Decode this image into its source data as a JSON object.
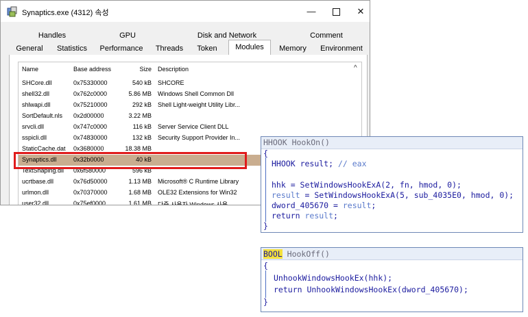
{
  "window": {
    "title": "Synaptics.exe (4312) 속성",
    "minimize_glyph": "—",
    "close_glyph": "✕"
  },
  "tabs": {
    "row1": [
      "Handles",
      "GPU",
      "Disk and Network",
      "Comment"
    ],
    "row2": [
      "General",
      "Statistics",
      "Performance",
      "Threads",
      "Token",
      "Modules",
      "Memory",
      "Environment"
    ],
    "selected": "Modules"
  },
  "modules_table": {
    "headers": [
      "Name",
      "Base address",
      "Size",
      "Description"
    ],
    "rows": [
      [
        "SHCore.dll",
        "0x75330000",
        "540 kB",
        "SHCORE"
      ],
      [
        "shell32.dll",
        "0x762c0000",
        "5.86 MB",
        "Windows Shell Common Dll"
      ],
      [
        "shlwapi.dll",
        "0x75210000",
        "292 kB",
        "Shell Light-weight Utility Libr..."
      ],
      [
        "SortDefault.nls",
        "0x2d00000",
        "3.22 MB",
        ""
      ],
      [
        "srvcli.dll",
        "0x747c0000",
        "116 kB",
        "Server Service Client DLL"
      ],
      [
        "sspicli.dll",
        "0x74830000",
        "132 kB",
        "Security Support Provider In..."
      ],
      [
        "StaticCache.dat",
        "0x3680000",
        "18.38 MB",
        ""
      ],
      [
        "Synaptics.dll",
        "0x32b0000",
        "40 kB",
        ""
      ],
      [
        "TextShaping.dll",
        "0x6f580000",
        "596 kB",
        ""
      ],
      [
        "ucrtbase.dll",
        "0x76d50000",
        "1.13 MB",
        "Microsoft® C Runtime Library"
      ],
      [
        "urlmon.dll",
        "0x70370000",
        "1.68 MB",
        "OLE32 Extensions for Win32"
      ],
      [
        "user32.dll",
        "0x75ef0000",
        "1.61 MB",
        "다중 사용자 Windows 사용"
      ]
    ],
    "selected_row": "Synaptics.dll",
    "scroll_up_glyph": "^"
  },
  "hookon": {
    "sig_type": "HHOOK",
    "sig_name": "HookOn()",
    "lines": {
      "open": "{",
      "decl_type": "HHOOK",
      "decl_var": "result;",
      "decl_comment": "// eax",
      "l1": "hhk = SetWindowsHookExA(2, fn, hmod, 0);",
      "l2_var": "result",
      "l2_rest": " = SetWindowsHookExA(5, sub_4035E0, hmod, 0);",
      "l3_a": "dword_405670 = ",
      "l3_b": "result",
      "l3_c": ";",
      "l4_a": "return ",
      "l4_b": "result",
      "l4_c": ";",
      "close": "}"
    }
  },
  "hookoff": {
    "sig_type": "BOOL",
    "sig_name": "HookOff()",
    "lines": {
      "open": "{",
      "l1": "UnhookWindowsHookEx(hhk);",
      "l2": "return UnhookWindowsHookEx(dword_405670);",
      "close": "}"
    }
  },
  "colors": {
    "highlight_border": "#e01b1b",
    "selected_row": "#c9ad8f",
    "code_keyword": "#1a1a9e",
    "bool_highlight": "#f4e13c"
  }
}
